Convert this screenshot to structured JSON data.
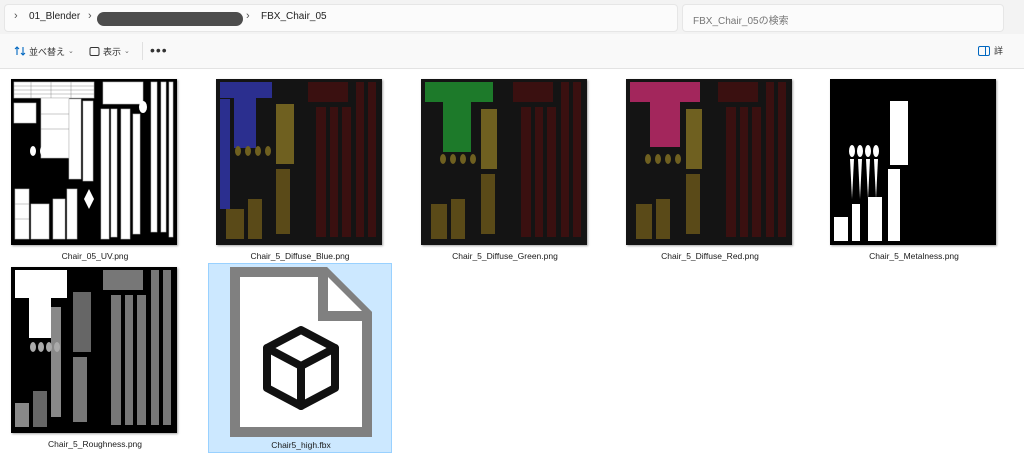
{
  "address": {
    "crumbs": [
      "01_Blender",
      "FBX_Chair_05"
    ],
    "search_placeholder": "FBX_Chair_05の検索"
  },
  "toolbar": {
    "sort_label": "並べ替え",
    "view_label": "表示",
    "more_label": "•••",
    "details_label": "詳"
  },
  "files": [
    {
      "name": "Chair_05_UV.png",
      "tint": "uv"
    },
    {
      "name": "Chair_5_Diffuse_Blue.png",
      "tint": "#2b2f8f"
    },
    {
      "name": "Chair_5_Diffuse_Green.png",
      "tint": "#1d7a2a"
    },
    {
      "name": "Chair_5_Diffuse_Red.png",
      "tint": "#a3265c"
    },
    {
      "name": "Chair_5_Metalness.png",
      "tint": "metal"
    },
    {
      "name": "Chair_5_Roughness.png",
      "tint": "rough"
    },
    {
      "name": "Chair5_high.fbx",
      "tint": "fbx-icon"
    }
  ]
}
